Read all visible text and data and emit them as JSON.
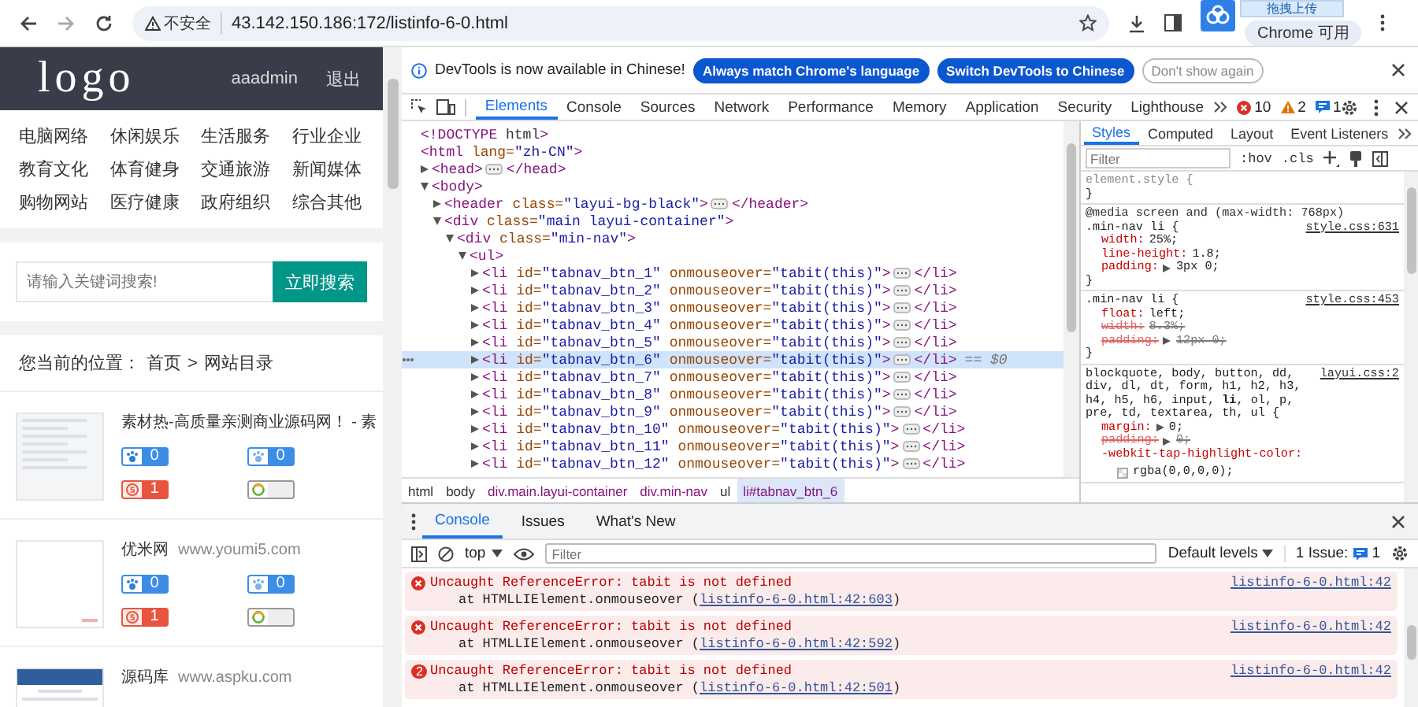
{
  "browser": {
    "security_label": "不安全",
    "url": "43.142.150.186:172/listinfo-6-0.html",
    "profile_text": "Chrome 可用",
    "popup_label": "拖拽上传"
  },
  "site": {
    "header": {
      "logo": "logo",
      "user": "aaadmin",
      "logout": "退出"
    },
    "nav": [
      "电脑网络",
      "休闲娱乐",
      "生活服务",
      "行业企业",
      "教育文化",
      "体育健身",
      "交通旅游",
      "新闻媒体",
      "购物网站",
      "医疗健康",
      "政府组织",
      "综合其他"
    ],
    "search": {
      "placeholder": "请输入关键词搜索!",
      "button": "立即搜索"
    },
    "breadcrumb": {
      "label": "您当前的位置：",
      "items": [
        "首页",
        "网站目录"
      ],
      "separator": ">"
    },
    "listings": [
      {
        "kind": "screenshot",
        "title": "素材热-高质量亲测商业源码网！ - 素",
        "badges": [
          {
            "kind": "baidu",
            "count": "0"
          },
          {
            "kind": "mobile",
            "count": "0"
          },
          {
            "kind": "sogou",
            "count": "1"
          },
          {
            "kind": "qihoo"
          }
        ]
      },
      {
        "kind": "blank",
        "title": "优米网",
        "url": "www.youmi5.com",
        "badges": [
          {
            "kind": "baidu",
            "count": "0"
          },
          {
            "kind": "mobile",
            "count": "0"
          },
          {
            "kind": "sogou",
            "count": "1"
          },
          {
            "kind": "qihoo"
          }
        ]
      },
      {
        "kind": "banner",
        "title": "源码库",
        "url": "www.aspku.com"
      }
    ]
  },
  "devtools": {
    "infobar": {
      "message": "DevTools is now available in Chinese!",
      "buttons": [
        {
          "label": "Always match Chrome's language",
          "kind": "primary"
        },
        {
          "label": "Switch DevTools to Chinese",
          "kind": "primary"
        },
        {
          "label": "Don't show again",
          "kind": "outline"
        }
      ]
    },
    "tabs": [
      {
        "label": "Elements",
        "selected": true
      },
      {
        "label": "Console",
        "selected": false
      },
      {
        "label": "Sources",
        "selected": false
      },
      {
        "label": "Network",
        "selected": false
      },
      {
        "label": "Performance",
        "selected": false
      },
      {
        "label": "Memory",
        "selected": false
      },
      {
        "label": "Application",
        "selected": false
      },
      {
        "label": "Security",
        "selected": false
      },
      {
        "label": "Lighthouse",
        "selected": false
      }
    ],
    "counters": {
      "errors": "10",
      "warnings": "2",
      "issues": "1"
    },
    "tree": [
      {
        "open": "<!DOCTYPE html>",
        "selected": false
      },
      {
        "open": "<html lang=\"zh-CN\">",
        "selected": false,
        "children": [
          {
            "open": "<head>",
            "close": "</head>",
            "expanded": false,
            "selected": false
          },
          {
            "open": "<body>",
            "expanded": true,
            "selected": false,
            "children": [
              {
                "open": "<header class=\"layui-bg-black\">",
                "close": "</header>",
                "expanded": false,
                "selected": false
              },
              {
                "open": "<div class=\"main layui-container\">",
                "expanded": true,
                "selected": false,
                "children": [
                  {
                    "open": "<div class=\"min-nav\">",
                    "expanded": true,
                    "selected": false,
                    "children": [
                      {
                        "open": "<ul>",
                        "expanded": true,
                        "selected": false,
                        "children": [
                          {
                            "open": "<li id=\"tabnav_btn_1\" onmouseover=\"tabit(this)\">",
                            "close": "</li>",
                            "expanded": false,
                            "selected": false
                          },
                          {
                            "open": "<li id=\"tabnav_btn_2\" onmouseover=\"tabit(this)\">",
                            "close": "</li>",
                            "expanded": false,
                            "selected": false
                          },
                          {
                            "open": "<li id=\"tabnav_btn_3\" onmouseover=\"tabit(this)\">",
                            "close": "</li>",
                            "expanded": false,
                            "selected": false
                          },
                          {
                            "open": "<li id=\"tabnav_btn_4\" onmouseover=\"tabit(this)\">",
                            "close": "</li>",
                            "expanded": false,
                            "selected": false
                          },
                          {
                            "open": "<li id=\"tabnav_btn_5\" onmouseover=\"tabit(this)\">",
                            "close": "</li>",
                            "expanded": false,
                            "selected": false
                          },
                          {
                            "open": "<li id=\"tabnav_btn_6\" onmouseover=\"tabit(this)\">",
                            "close": "</li>",
                            "expanded": false,
                            "selected": true,
                            "marker": "== $0"
                          },
                          {
                            "open": "<li id=\"tabnav_btn_7\" onmouseover=\"tabit(this)\">",
                            "close": "</li>",
                            "expanded": false,
                            "selected": false
                          },
                          {
                            "open": "<li id=\"tabnav_btn_8\" onmouseover=\"tabit(this)\">",
                            "close": "</li>",
                            "expanded": false,
                            "selected": false
                          },
                          {
                            "open": "<li id=\"tabnav_btn_9\" onmouseover=\"tabit(this)\">",
                            "close": "</li>",
                            "expanded": false,
                            "selected": false
                          },
                          {
                            "open": "<li id=\"tabnav_btn_10\" onmouseover=\"tabit(this)\">",
                            "close": "</li>",
                            "expanded": false,
                            "selected": false
                          },
                          {
                            "open": "<li id=\"tabnav_btn_11\" onmouseover=\"tabit(this)\">",
                            "close": "</li>",
                            "expanded": false,
                            "selected": false
                          },
                          {
                            "open": "<li id=\"tabnav_btn_12\" onmouseover=\"tabit(this)\">",
                            "close": "</li>",
                            "expanded": false,
                            "selected": false
                          }
                        ]
                      }
                    ]
                  }
                ]
              }
            ]
          }
        ]
      }
    ],
    "breadcrumbs": [
      {
        "label": "html",
        "selected": false
      },
      {
        "label": "body",
        "selected": false
      },
      {
        "label": "div.main.layui-container",
        "selected": false
      },
      {
        "label": "div.min-nav",
        "selected": false
      },
      {
        "label": "ul",
        "selected": false
      },
      {
        "label": "li#tabnav_btn_6",
        "selected": true
      }
    ],
    "styles": {
      "tabs": [
        {
          "label": "Styles",
          "selected": true
        },
        {
          "label": "Computed",
          "selected": false
        },
        {
          "label": "Layout",
          "selected": false
        },
        {
          "label": "Event Listeners",
          "selected": false
        }
      ],
      "filter_placeholder": "Filter",
      "toggles": [
        ":hov",
        ".cls"
      ],
      "rules": [
        {
          "selector": "element.style {",
          "close": "}"
        },
        {
          "media": "@media screen and (max-width: 768px)",
          "selector": ".min-nav li {",
          "source": "style.css:631",
          "close": "}",
          "declarations": [
            {
              "property": "width:",
              "value": "25%;",
              "struck": false,
              "expandable": false,
              "swatch": false
            },
            {
              "property": "line-height:",
              "value": "1.8;",
              "struck": false,
              "expandable": false,
              "swatch": false
            },
            {
              "property": "padding:",
              "value": "3px 0;",
              "struck": false,
              "expandable": true,
              "swatch": false
            }
          ]
        },
        {
          "selector": ".min-nav li {",
          "source": "style.css:453",
          "close": "}",
          "declarations": [
            {
              "property": "float:",
              "value": "left;",
              "struck": false,
              "expandable": false,
              "swatch": false
            },
            {
              "property": "width:",
              "value": "8.3%;",
              "struck": true,
              "expandable": false,
              "swatch": false
            },
            {
              "property": "padding:",
              "value": "12px 0;",
              "struck": true,
              "expandable": true,
              "swatch": false
            }
          ]
        },
        {
          "selector": "blockquote, body, button, dd, div, dl, dt, form, h1, h2, h3, h4, h5, h6, input, **li**, ol, p, pre, td, textarea, th, ul {",
          "source": "layui.css:2",
          "declarations": [
            {
              "property": "margin:",
              "value": "0;",
              "struck": false,
              "expandable": true,
              "swatch": false
            },
            {
              "property": "padding:",
              "value": "0;",
              "struck": true,
              "expandable": true,
              "swatch": false
            },
            {
              "property": "-webkit-tap-highlight-color:",
              "value": "rgba(0,0,0,0);",
              "struck": false,
              "expandable": false,
              "swatch": true
            }
          ]
        }
      ]
    },
    "drawer": {
      "tabs": [
        {
          "label": "Console",
          "selected": true
        },
        {
          "label": "Issues",
          "selected": false
        },
        {
          "label": "What's New",
          "selected": false
        }
      ],
      "context": "top",
      "filter_placeholder": "Filter",
      "levels": "Default levels",
      "issues_label": "1 Issue:",
      "issues_count": "1",
      "messages": [
        {
          "text": "Uncaught ReferenceError: tabit is not defined",
          "stack": "at HTMLLIElement.onmouseover (",
          "stack_link": "listinfo-6-0.html:42:603",
          "stack_end": ")",
          "source": "listinfo-6-0.html:42"
        },
        {
          "text": "Uncaught ReferenceError: tabit is not defined",
          "stack": "at HTMLLIElement.onmouseover (",
          "stack_link": "listinfo-6-0.html:42:592",
          "stack_end": ")",
          "source": "listinfo-6-0.html:42"
        },
        {
          "text": "Uncaught ReferenceError: tabit is not defined",
          "stack": "at HTMLLIElement.onmouseover (",
          "stack_link": "listinfo-6-0.html:42:501",
          "stack_end": ")",
          "source": "listinfo-6-0.html:42",
          "repeat": "2"
        }
      ]
    }
  }
}
